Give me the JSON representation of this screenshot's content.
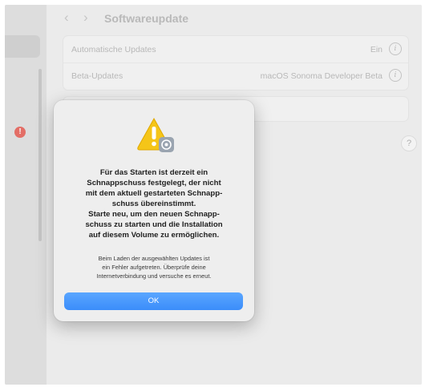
{
  "window": {
    "title": "Softwareupdate",
    "nav": {
      "back": "‹",
      "forward": "›"
    }
  },
  "sidebar": {
    "badge": "!"
  },
  "settings": {
    "rows": [
      {
        "label": "Automatische Updates",
        "value": "Ein"
      },
      {
        "label": "Beta-Updates",
        "value": "macOS Sonoma Developer Beta"
      }
    ],
    "help": "?"
  },
  "dialog": {
    "title": "Für das Starten ist derzeit ein\nSchnappschuss festgelegt, der nicht\nmit dem aktuell gestarteten Schnapp-\nschuss übereinstimmt.\nStarte neu, um den neuen Schnapp-\nschuss zu starten und die Installation\nauf diesem Volume zu ermöglichen.",
    "message": "Beim Laden der ausgewählten Updates ist\nein Fehler aufgetreten. Überprüfe deine\nInternetverbindung und versuche es erneut.",
    "ok_label": "OK"
  },
  "colors": {
    "accent": "#3b8dfa",
    "warning": "#f5c518",
    "badge": "#e0443a"
  }
}
